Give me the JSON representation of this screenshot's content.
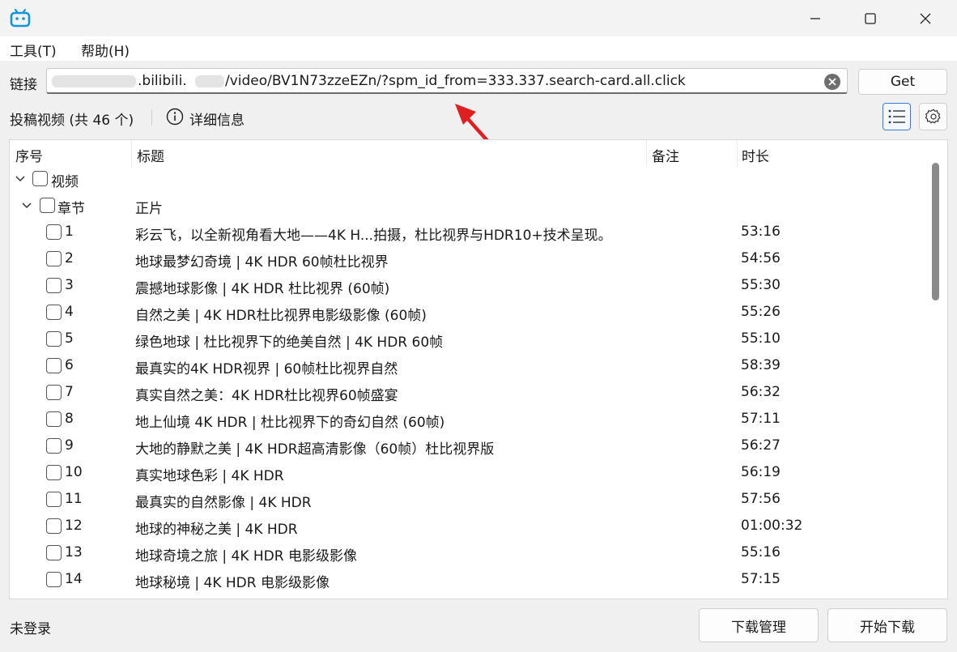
{
  "window": {
    "minimize": "—",
    "maximize": "□",
    "close": "×"
  },
  "menu": [
    {
      "label": "工具(T)"
    },
    {
      "label": "帮助(H)"
    }
  ],
  "url": {
    "label": "链接",
    "host": ".bilibili.",
    "path": "/video/BV1N73zzeEZn/?spm_id_from=333.337.search-card.all.click",
    "get_label": "Get"
  },
  "info": {
    "count_label": "投稿视频 (共 46 个)",
    "detail_label": "详细信息"
  },
  "table": {
    "headers": {
      "index": "序号",
      "title": "标题",
      "note": "备注",
      "duration": "时长"
    },
    "group_label": "视频",
    "section_label": "章节",
    "section_title": "正片",
    "rows": [
      {
        "index": "1",
        "title": "彩云飞，以全新视角看大地——4K H...拍摄，杜比视界与HDR10+技术呈现。",
        "duration": "53:16"
      },
      {
        "index": "2",
        "title": "地球最梦幻奇境 | 4K HDR 60帧杜比视界",
        "duration": "54:56"
      },
      {
        "index": "3",
        "title": "震撼地球影像 | 4K HDR 杜比视界 (60帧)",
        "duration": "55:30"
      },
      {
        "index": "4",
        "title": "自然之美 | 4K HDR杜比视界电影级影像 (60帧)",
        "duration": "55:26"
      },
      {
        "index": "5",
        "title": "绿色地球 | 杜比视界下的绝美自然 | 4K HDR 60帧",
        "duration": "55:10"
      },
      {
        "index": "6",
        "title": "最真实的4K HDR视界 | 60帧杜比视界自然",
        "duration": "58:39"
      },
      {
        "index": "7",
        "title": "真实自然之美：4K HDR杜比视界60帧盛宴",
        "duration": "56:32"
      },
      {
        "index": "8",
        "title": "地上仙境 4K HDR | 杜比视界下的奇幻自然 (60帧)",
        "duration": "57:11"
      },
      {
        "index": "9",
        "title": "大地的静默之美 | 4K HDR超高清影像（60帧）杜比视界版",
        "duration": "56:27"
      },
      {
        "index": "10",
        "title": "真实地球色彩 | 4K HDR",
        "duration": "56:19"
      },
      {
        "index": "11",
        "title": "最真实的自然影像 | 4K HDR",
        "duration": "57:56"
      },
      {
        "index": "12",
        "title": "地球的神秘之美 | 4K HDR",
        "duration": "01:00:32"
      },
      {
        "index": "13",
        "title": "地球奇境之旅 | 4K HDR 电影级影像",
        "duration": "55:16"
      },
      {
        "index": "14",
        "title": "地球秘境 | 4K HDR 电影级影像",
        "duration": "57:15"
      }
    ]
  },
  "status": {
    "login": "未登录"
  },
  "actions": {
    "manage_label": "下载管理",
    "start_label": "开始下载"
  },
  "colors": {
    "accent": "#3a7bd5",
    "annotation": "#e02020",
    "app_icon": "#1296db"
  }
}
